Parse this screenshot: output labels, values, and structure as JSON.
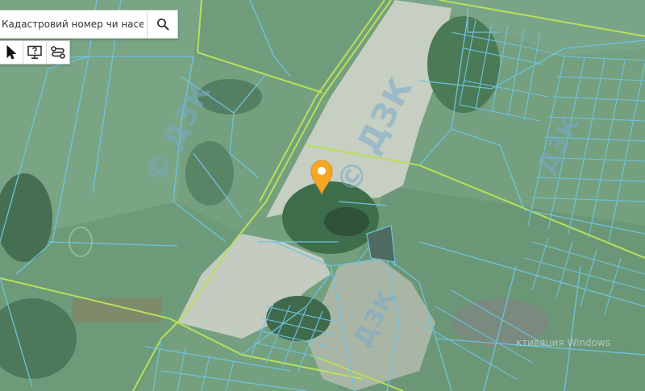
{
  "map": {
    "type": "cadastral satellite map",
    "basemap": "satellite imagery",
    "colors": {
      "parcel_border": "#6fc3e0",
      "highlight_border": "#b8e05a",
      "marker": "#f5a623",
      "field_light": "#c9d1c4",
      "field_green": "#6e9a78",
      "forest": "#3e6b4c"
    }
  },
  "search": {
    "placeholder": "Кадастровий номер чи населений п",
    "button_icon": "search-icon"
  },
  "toolbar": {
    "tools": [
      {
        "name": "select-tool",
        "icon": "cursor-arrow-icon"
      },
      {
        "name": "help-tool",
        "icon": "monitor-question-icon"
      },
      {
        "name": "route-tool",
        "icon": "route-icon"
      }
    ]
  },
  "watermarks": {
    "labels": [
      "© ДЗК",
      "© ДЗК",
      "ДЗК",
      "ДЗК"
    ]
  },
  "marker": {
    "icon": "map-pin-icon"
  },
  "windows_watermark": {
    "text": "ктивация Windows"
  }
}
